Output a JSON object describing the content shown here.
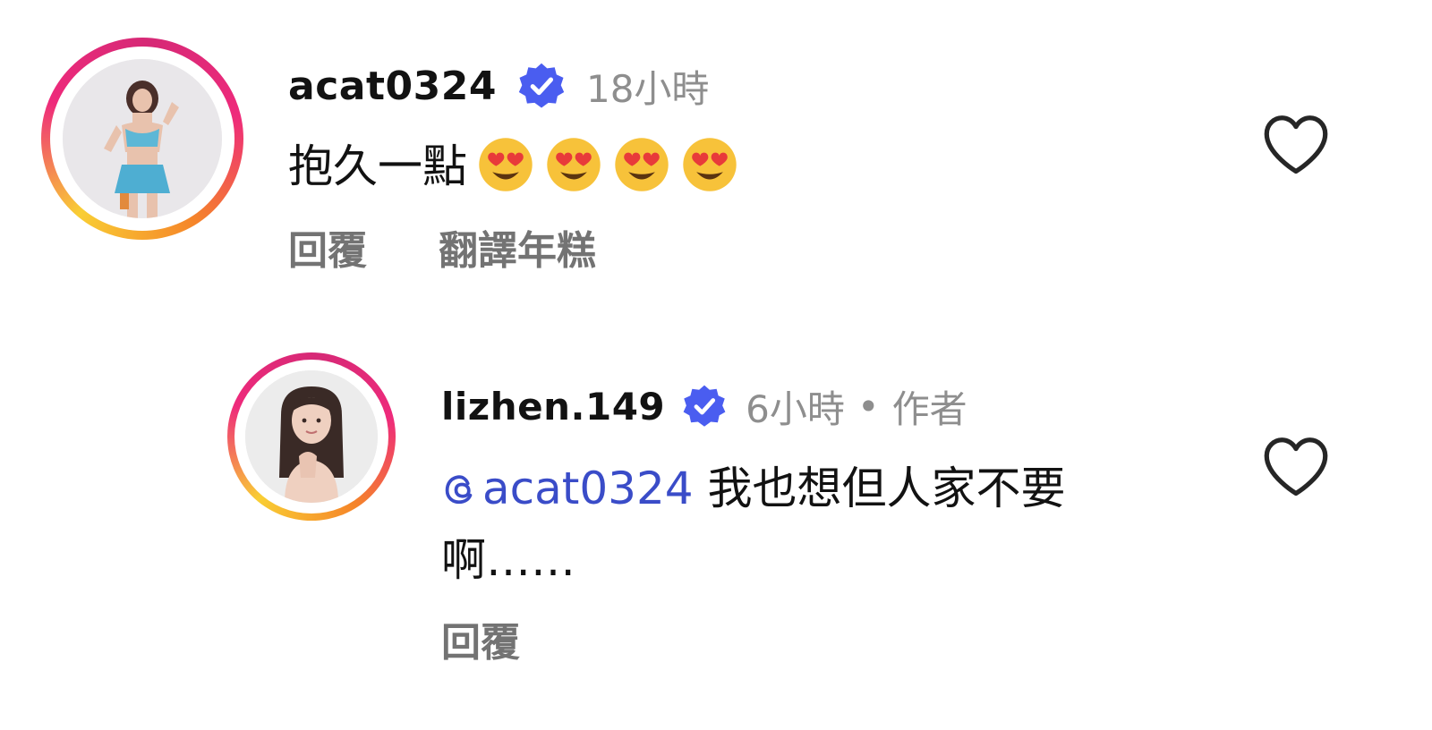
{
  "comments": [
    {
      "username": "acat0324",
      "verified_icon": "verified-badge-icon",
      "time": "18小時",
      "text": "抱久一點",
      "emojis": [
        "smiling-face-with-heart-eyes",
        "smiling-face-with-heart-eyes",
        "smiling-face-with-heart-eyes",
        "smiling-face-with-heart-eyes"
      ],
      "actions": {
        "reply": "回覆",
        "translate": "翻譯年糕"
      },
      "like_icon": "heart-outline-icon"
    },
    {
      "username": "lizhen.149",
      "verified_icon": "verified-badge-icon",
      "time": "6小時",
      "separator": "•",
      "author_tag": "作者",
      "mention": "acat0324",
      "text": "我也想但人家不要啊……",
      "actions": {
        "reply": "回覆"
      },
      "like_icon": "heart-outline-icon"
    }
  ],
  "colors": {
    "verified_blue": "#4a5df0",
    "mention_blue": "#3a4cc8",
    "muted_gray": "#8e8e8e"
  }
}
